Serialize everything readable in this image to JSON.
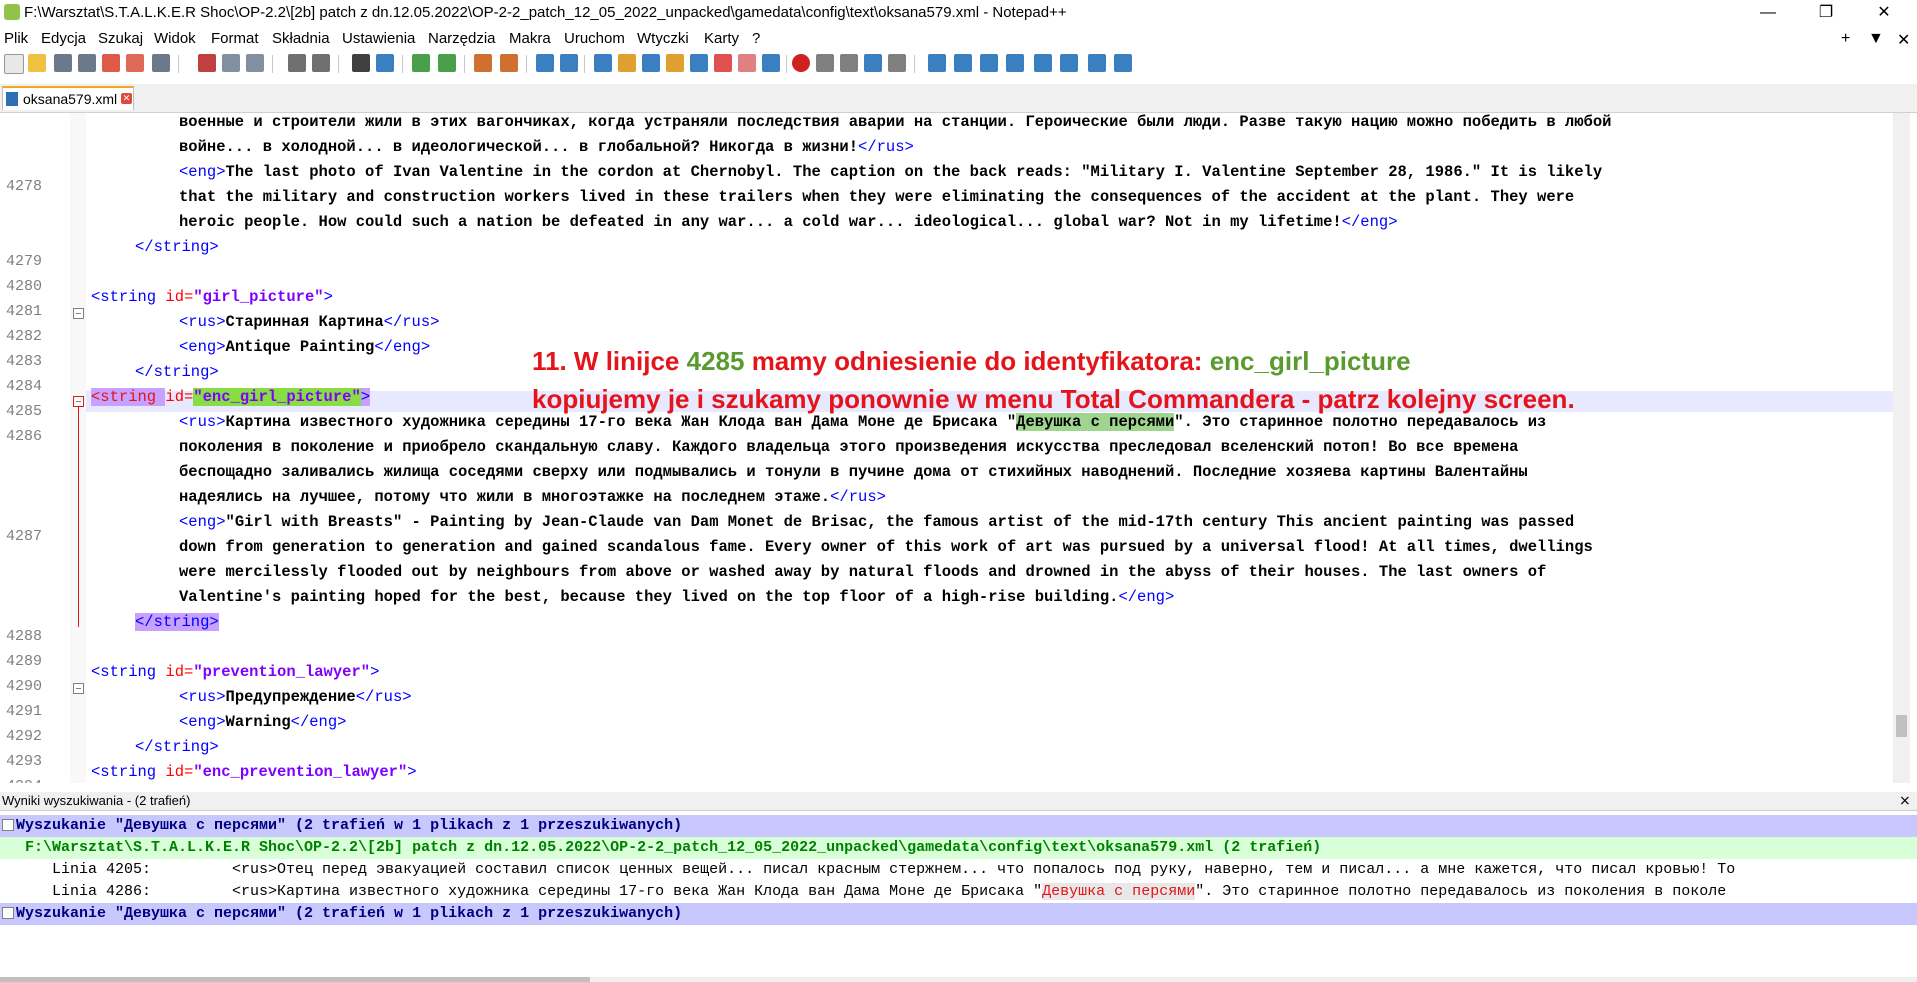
{
  "window": {
    "title": "F:\\Warsztat\\S.T.A.L.K.E.R Shoc\\OP-2.2\\[2b] patch z dn.12.05.2022\\OP-2-2_patch_12_05_2022_unpacked\\gamedata\\config\\text\\oksana579.xml - Notepad++",
    "minimize": "—",
    "maximize": "❐",
    "close": "✕"
  },
  "menu": {
    "items": [
      "Plik",
      "Edycja",
      "Szukaj",
      "Widok",
      "Format",
      "Składnia",
      "Ustawienia",
      "Narzędzia",
      "Makra",
      "Uruchom",
      "Wtyczki",
      "Karty",
      "?"
    ],
    "right": [
      "+",
      "▼",
      "✕"
    ]
  },
  "tab": {
    "label": "oksana579.xml"
  },
  "editor": {
    "line_numbers": [
      "4278",
      "4279",
      "4280",
      "4281",
      "4282",
      "4283",
      "4284",
      "4285",
      "4286",
      "4287",
      "4288",
      "4289",
      "4290",
      "4291",
      "4292",
      "4293",
      "4294"
    ],
    "lines": {
      "l0": "военные и строители жили в этих вагончиках, когда устраняли последствия аварии на станции. Героические были люди. Разве такую нацию можно победить в любой",
      "l1a": "войне... в холодной... в идеологической... в глобальной? Никогда в жизни!",
      "l1b": "</rus>",
      "l2a": "<eng>",
      "l2b": "The last photo of Ivan Valentine in the cordon at Chernobyl. The caption on the back reads: \"Military I. Valentine September 28, 1986.\" It is likely",
      "l3": "that the military and construction workers lived in these trailers when they were eliminating the consequences of the accident at the plant. They were",
      "l4a": "heroic people. How could such a nation be defeated in any war... a cold war... ideological... global war? Not in my lifetime!",
      "l4b": "</eng>",
      "l5": "</string>",
      "l7a": "<string ",
      "l7b": "id=",
      "l7c": "\"girl_picture\"",
      "l7d": ">",
      "l8a": "<rus>",
      "l8b": "Старинная Картина",
      "l8c": "</rus>",
      "l9a": "<eng>",
      "l9b": "Antique Painting",
      "l9c": "</eng>",
      "l10": "</string>",
      "l11a": "<string ",
      "l11b": "id=",
      "l11c": "\"enc_girl_picture\"",
      "l11d": ">",
      "l12a": "<rus>",
      "l12b": "Картина известного художника середины 17-го века Жан Клода ван Дама Моне де Брисака \"",
      "l12c": "Девушка с персями",
      "l12d": "\". Это старинное полотно передавалось из",
      "l13": "поколения в поколение и приобрело скандальную славу. Каждого владельца этого произведения искусства преследовал вселенский потоп! Во все времена",
      "l14": "беспощадно заливались жилища соседями сверху или подмывались и тонули в пучине дома от стихийных наводнений. Последние хозяева картины Валентайны",
      "l15a": "надеялись на лучшее, потому что жили в многоэтажке на последнем этаже.",
      "l15b": "</rus>",
      "l16a": "<eng>",
      "l16b": "\"Girl with Breasts\" - Painting by Jean-Claude van Dam Monet de Brisac, the famous artist of the mid-17th century This ancient painting was passed",
      "l17": "down from generation to generation and gained scandalous fame. Every owner of this work of art was pursued by a universal flood! At all times, dwellings",
      "l18": "were mercilessly flooded out by neighbours from above or washed away by natural floods and drowned in the abyss of their houses. The last owners of",
      "l19a": "Valentine's painting hoped for the best, because they lived on the top floor of a high-rise building.",
      "l19b": "</eng>",
      "l20": "</string>",
      "l22a": "<string ",
      "l22b": "id=",
      "l22c": "\"prevention_lawyer\"",
      "l22d": ">",
      "l23a": "<rus>",
      "l23b": "Предупреждение",
      "l23c": "</rus>",
      "l24a": "<eng>",
      "l24b": "Warning",
      "l24c": "</eng>",
      "l25": "</string>",
      "l26a": "<string ",
      "l26b": "id=",
      "l26c": "\"enc_prevention_lawyer\"",
      "l26d": ">"
    }
  },
  "annotation": {
    "line1_a": "11.  W linijce ",
    "line1_b": "4285",
    "line1_c": " mamy odniesienie do identyfikatora:  ",
    "line1_d": "enc_girl_picture",
    "line2": "kopiujemy je i szukamy ponownie w menu Total Commandera - patrz kolejny screen."
  },
  "results": {
    "header": "Wyniki wyszukiwania - (2 trafień)",
    "search_row": "Wyszukanie \"Девушка с персями\" (2 trafień w 1 plikach z 1 przeszukiwanych)",
    "file_row": " F:\\Warsztat\\S.T.A.L.K.E.R Shoc\\OP-2.2\\[2b] patch z dn.12.05.2022\\OP-2-2_patch_12_05_2022_unpacked\\gamedata\\config\\text\\oksana579.xml (2 trafień)",
    "hit1": "    Linia 4205:         <rus>Отец перед эвакуацией составил список ценных вещей... писал красным стержнем... что попалось под руку, наверно, тем и писал... а мне кажется, что писал кровью! То",
    "hit2_a": "    Linia 4286:         <rus>Картина известного художника середины 17-го века Жан Клода ван Дама Моне де Брисака \"",
    "hit2_b": "Девушка с персями",
    "hit2_c": "\". Это старинное полотно передавалось из поколения в поколе",
    "search_row2": "Wyszukanie \"Девушка с персями\" (2 trafień w 1 plikach z 1 przeszukiwanych)",
    "close": "⨯"
  }
}
